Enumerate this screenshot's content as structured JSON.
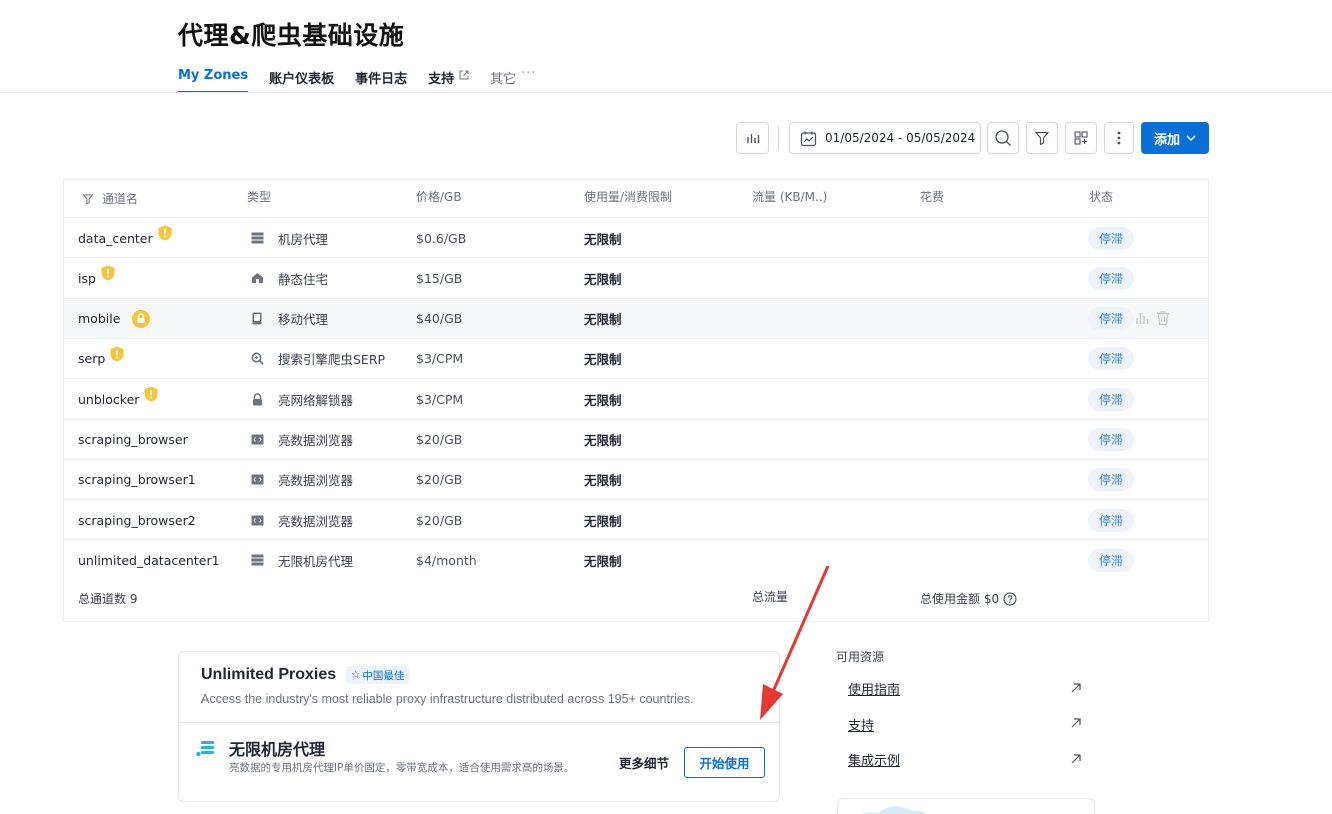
{
  "header": {
    "title": "代理&爬虫基础设施",
    "tabs": [
      {
        "label": "My Zones",
        "active": true
      },
      {
        "label": "账户仪表板"
      },
      {
        "label": "事件日志"
      },
      {
        "label": "支持",
        "external": true
      },
      {
        "label": "其它"
      }
    ]
  },
  "toolbar": {
    "date_range": "01/05/2024 - 05/05/2024",
    "add_label": "添加"
  },
  "table": {
    "headers": {
      "name": "通道名",
      "type": "类型",
      "price": "价格/GB",
      "usage": "使用量/消费限制",
      "traffic": "流量 (KB/M..)",
      "cost": "花费",
      "status": "状态"
    },
    "rows": [
      {
        "name": "data_center",
        "type": "机房代理",
        "type_icon": "server-icon",
        "price": "$0.6/GB",
        "usage": "无限制",
        "status": "停滞",
        "badge": "warning"
      },
      {
        "name": "isp",
        "type": "静态住宅",
        "type_icon": "home-icon",
        "price": "$15/GB",
        "usage": "无限制",
        "status": "停滞",
        "badge": "warning"
      },
      {
        "name": "mobile",
        "type": "移动代理",
        "type_icon": "phone-icon",
        "price": "$40/GB",
        "usage": "无限制",
        "status": "停滞",
        "badge": "lock"
      },
      {
        "name": "serp",
        "type": "搜索引擎爬虫SERP",
        "type_icon": "search-icon",
        "price": "$3/CPM",
        "usage": "无限制",
        "status": "停滞",
        "badge": "warning"
      },
      {
        "name": "unblocker",
        "type": "亮网络解锁器",
        "type_icon": "lock-icon",
        "price": "$3/CPM",
        "usage": "无限制",
        "status": "停滞",
        "badge": "warning"
      },
      {
        "name": "scraping_browser",
        "type": "亮数据浏览器",
        "type_icon": "code-icon",
        "price": "$20/GB",
        "usage": "无限制",
        "status": "停滞"
      },
      {
        "name": "scraping_browser1",
        "type": "亮数据浏览器",
        "type_icon": "code-icon",
        "price": "$20/GB",
        "usage": "无限制",
        "status": "停滞"
      },
      {
        "name": "scraping_browser2",
        "type": "亮数据浏览器",
        "type_icon": "code-icon",
        "price": "$20/GB",
        "usage": "无限制",
        "status": "停滞"
      },
      {
        "name": "unlimited_datacenter1",
        "type": "无限机房代理",
        "type_icon": "server-icon",
        "price": "$4/month",
        "usage": "无限制",
        "status": "停滞"
      }
    ],
    "footer": {
      "count": "总通道数 9",
      "traffic": "总流量",
      "cost": "总使用金额 $0"
    }
  },
  "promo": {
    "title": "Unlimited Proxies",
    "tag": "中国最佳",
    "subtitle": "Access the industry's most reliable proxy infrastructure distributed across 195+ countries.",
    "product_name": "无限机房代理",
    "product_desc": "亮数据的专用机房代理IP单价固定，零带宽成本，适合使用需求高的场景。",
    "more_label": "更多细节",
    "start_label": "开始使用"
  },
  "resources": {
    "title": "可用资源",
    "links": [
      "使用指南",
      "支持",
      "集成示例"
    ]
  },
  "colors": {
    "accent": "#0a6fd6",
    "status_badge_bg": "#eef3fb",
    "status_badge_text": "#3b8ad8",
    "warning": "#f7c43d",
    "annotation": "#e53935"
  }
}
